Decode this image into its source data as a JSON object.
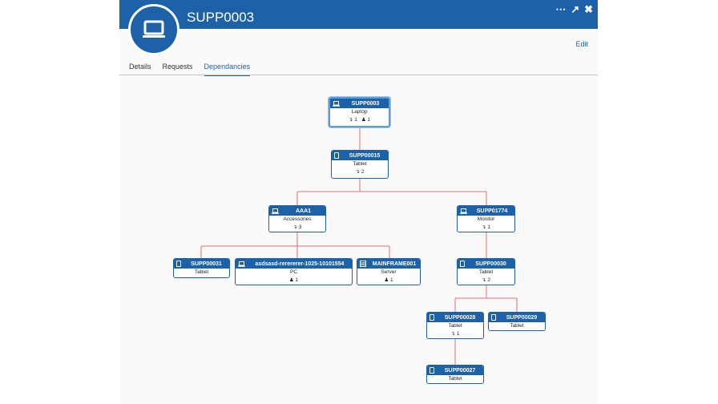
{
  "header": {
    "title": "SUPP0003",
    "edit_label": "Edit",
    "more": "⋯",
    "popout": "↗",
    "close": "✖"
  },
  "tabs": [
    {
      "label": "Details"
    },
    {
      "label": "Requests"
    },
    {
      "label": "Dependancies"
    }
  ],
  "nodes": {
    "supp0003": {
      "name": "SUPP0003",
      "type": "Laptop",
      "deps": "1",
      "users": "1"
    },
    "supp00015": {
      "name": "SUPP00015",
      "type": "Tablet",
      "deps": "2"
    },
    "aaa1": {
      "name": "AAA1",
      "type": "Accessories",
      "deps": "3"
    },
    "supp01774": {
      "name": "SUPP01774",
      "type": "Monitor",
      "deps": "1"
    },
    "supp00031": {
      "name": "SUPP00031",
      "type": "Tablet"
    },
    "asdsasd": {
      "name": "asdsasd-rerererer-1025-10101554",
      "type": "PC",
      "users": "1"
    },
    "mainframe": {
      "name": "MAINFRAME001",
      "type": "Server",
      "users": "1"
    },
    "supp00030": {
      "name": "SUPP00030",
      "type": "Tablet",
      "deps": "2"
    },
    "supp00028": {
      "name": "SUPP00028",
      "type": "Tablet",
      "deps": "1"
    },
    "supp00029": {
      "name": "SUPP00029",
      "type": "Tablet"
    },
    "supp00027": {
      "name": "SUPP00027",
      "type": "Tablet"
    }
  },
  "colors": {
    "accent": "#1d62a8",
    "connector": "#e07070"
  }
}
